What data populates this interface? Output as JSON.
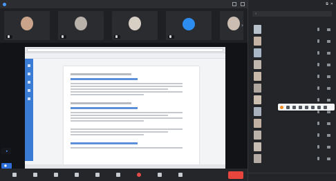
{
  "topbar": {
    "left_items": [
      "",
      "",
      ""
    ],
    "right_items": [
      "",
      ""
    ]
  },
  "video_strip": {
    "tiles": [
      {
        "name": "",
        "face_color": "#c9a48a"
      },
      {
        "name": "",
        "face_color": "#b9b2ab"
      },
      {
        "name": "",
        "face_color": "#d8cfc4"
      },
      {
        "name": "",
        "face_color": "#cbbdb2"
      },
      {
        "name": "",
        "avatar_text": "",
        "face_color": "#2d8cf0"
      }
    ]
  },
  "shared_screen": {
    "doc_sections": 4
  },
  "overlays": {
    "subtitle_chip": "",
    "speaking_chip": ""
  },
  "toolbar": {
    "buttons": [
      {
        "icon": "mic-icon",
        "label": ""
      },
      {
        "icon": "video-icon",
        "label": ""
      },
      {
        "icon": "shield-icon",
        "label": ""
      },
      {
        "icon": "members-icon",
        "label": ""
      },
      {
        "icon": "chat-icon",
        "label": ""
      },
      {
        "icon": "share-icon",
        "label": ""
      },
      {
        "icon": "record-icon",
        "label": ""
      },
      {
        "icon": "apps-icon",
        "label": ""
      },
      {
        "icon": "more-icon",
        "label": ""
      }
    ],
    "leave_label": ""
  },
  "panel": {
    "title": "",
    "search_placeholder": "",
    "group_label": "",
    "members": [
      {
        "name": "",
        "avatar_color": "#b7c1cc"
      },
      {
        "name": "",
        "avatar_color": "#c4b3a4"
      },
      {
        "name": "",
        "avatar_color": "#a8b6c6"
      },
      {
        "name": "",
        "avatar_color": "#bfb7ae"
      },
      {
        "name": "",
        "avatar_color": "#c9b9a8"
      },
      {
        "name": "",
        "avatar_color": "#b0a89f"
      },
      {
        "name": "",
        "avatar_color": "#cdbfb0"
      },
      {
        "name": "",
        "avatar_color": "#a9b2bd"
      },
      {
        "name": "",
        "avatar_color": "#c2b1a2"
      },
      {
        "name": "",
        "avatar_color": "#bbb3aa"
      },
      {
        "name": "",
        "avatar_color": "#c8bdb2"
      },
      {
        "name": "",
        "avatar_color": "#b4aca4"
      }
    ],
    "footer": [
      "",
      "",
      ""
    ]
  },
  "colors": {
    "accent": "#2d8cf0",
    "leave": "#e8453c",
    "annotation_active": "#f08a24"
  }
}
